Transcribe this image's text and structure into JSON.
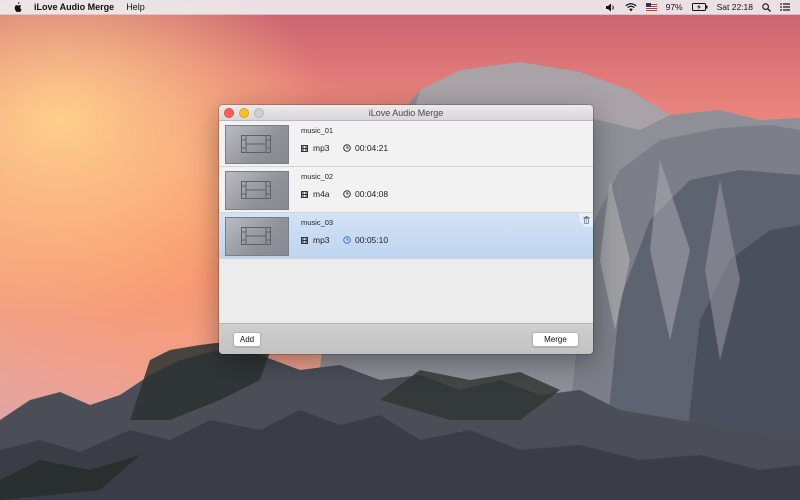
{
  "menubar": {
    "apple_icon": "apple-icon",
    "app_name": "iLove Audio Merge",
    "menus": [
      "Help"
    ],
    "status": {
      "battery_percent": "97%",
      "clock": "Sat 22:18",
      "icons": [
        "volume-icon",
        "wifi-icon",
        "flag-icon",
        "battery-icon",
        "search-icon",
        "list-icon"
      ]
    }
  },
  "window": {
    "title": "iLove Audio Merge",
    "files": [
      {
        "name": "music_01",
        "format": "mp3",
        "duration": "00:04:21",
        "selected": false
      },
      {
        "name": "music_02",
        "format": "m4a",
        "duration": "00:04:08",
        "selected": false
      },
      {
        "name": "music_03",
        "format": "mp3",
        "duration": "00:05:10",
        "selected": true
      }
    ],
    "buttons": {
      "add": "Add",
      "merge": "Merge"
    }
  },
  "colors": {
    "selection": "#c9dbf1",
    "close": "#fc5f57",
    "minimize": "#fdbc2e",
    "clock_icon_selected": "#3a7bd5"
  }
}
